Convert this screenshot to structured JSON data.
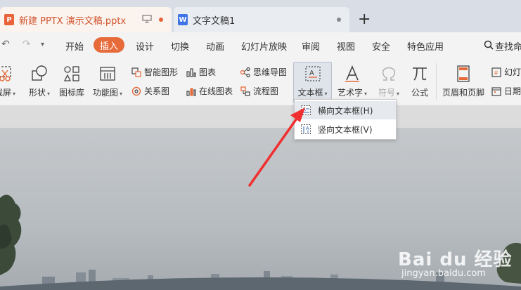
{
  "tabs": [
    {
      "title": "新建 PPTX 演示文稿.pptx",
      "logo": "P",
      "logo_color": "#e8633a"
    },
    {
      "title": "文字文稿1",
      "logo": "W",
      "logo_color": "#3f73e8"
    }
  ],
  "menu": {
    "items": [
      "开始",
      "插入",
      "设计",
      "切换",
      "动画",
      "幻灯片放映",
      "审阅",
      "视图",
      "安全",
      "特色应用"
    ],
    "active": "插入",
    "search_label": "查找命"
  },
  "ribbon": {
    "screenshot_label": "截屏",
    "shape_label": "形状",
    "icon_lib_label": "图标库",
    "func_chart_label": "功能图",
    "smart_shape_label": "智能图形",
    "chart_label": "图表",
    "mindmap_label": "思维导图",
    "relation_label": "关系图",
    "online_chart_label": "在线图表",
    "flowchart_label": "流程图",
    "textbox_label": "文本框",
    "arttext_label": "艺术字",
    "symbol_label": "符号",
    "formula_label": "公式",
    "header_footer_label": "页眉和页脚",
    "slide_num_label": "幻灯",
    "date_label": "日期"
  },
  "dropdown": {
    "items": [
      {
        "label": "横向文本框(H)"
      },
      {
        "label": "竖向文本框(V)"
      }
    ]
  },
  "watermark": {
    "brand": "Bai du 经验",
    "url": "jingyan.baidu.com"
  },
  "colors": {
    "accent": "#e66a3a",
    "arrow": "#f03030"
  }
}
